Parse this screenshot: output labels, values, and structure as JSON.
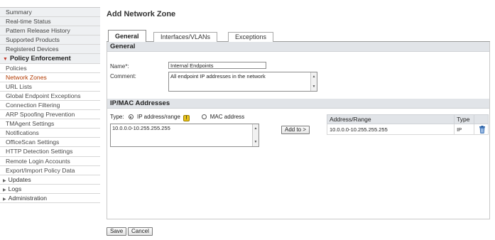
{
  "sidebar": {
    "items": [
      {
        "label": "Summary",
        "kind": "top"
      },
      {
        "label": "Real-time Status",
        "kind": "top"
      },
      {
        "label": "Pattern Release History",
        "kind": "top"
      },
      {
        "label": "Supported Products",
        "kind": "top"
      },
      {
        "label": "Registered Devices",
        "kind": "top"
      },
      {
        "label": "Policy Enforcement",
        "kind": "section"
      },
      {
        "label": "Policies",
        "kind": "sub"
      },
      {
        "label": "Network Zones",
        "kind": "sub-active"
      },
      {
        "label": "URL Lists",
        "kind": "sub"
      },
      {
        "label": "Global Endpoint Exceptions",
        "kind": "sub"
      },
      {
        "label": "Connection Filtering",
        "kind": "sub"
      },
      {
        "label": "ARP Spoofing Prevention",
        "kind": "sub"
      },
      {
        "label": "TMAgent Settings",
        "kind": "sub"
      },
      {
        "label": "Notifications",
        "kind": "sub"
      },
      {
        "label": "OfficeScan Settings",
        "kind": "sub"
      },
      {
        "label": "HTTP Detection Settings",
        "kind": "sub"
      },
      {
        "label": "Remote Login Accounts",
        "kind": "sub"
      },
      {
        "label": "Export/Import Policy Data",
        "kind": "sub"
      },
      {
        "label": "Updates",
        "kind": "collapsed"
      },
      {
        "label": "Logs",
        "kind": "collapsed"
      },
      {
        "label": "Administration",
        "kind": "collapsed"
      }
    ]
  },
  "main": {
    "title": "Add Network Zone",
    "tabs": [
      {
        "label": "General"
      },
      {
        "label": "Interfaces/VLANs"
      },
      {
        "label": "Exceptions"
      }
    ],
    "general": {
      "header": "General",
      "name_label": "Name*:",
      "name_value": "Internal Endpoints",
      "comment_label": "Comment:",
      "comment_value": "All endpoint IP addresses in the network"
    },
    "ipmac": {
      "header": "IP/MAC Addresses",
      "type_label": "Type:",
      "opt_ip": "IP address/range",
      "opt_mac": "MAC address",
      "input_value": "10.0.0.0-10.255.255.255",
      "add_button": "Add to >",
      "table_headers": [
        "Address/Range",
        "Type"
      ],
      "rows": [
        {
          "address": "10.0.0.0-10.255.255.255",
          "type": "IP"
        }
      ]
    },
    "save_label": "Save",
    "cancel_label": "Cancel"
  },
  "colors": {
    "active_nav": "#b23a00",
    "section_bg": "#e1e4e8",
    "trash": "#2a62a8"
  }
}
